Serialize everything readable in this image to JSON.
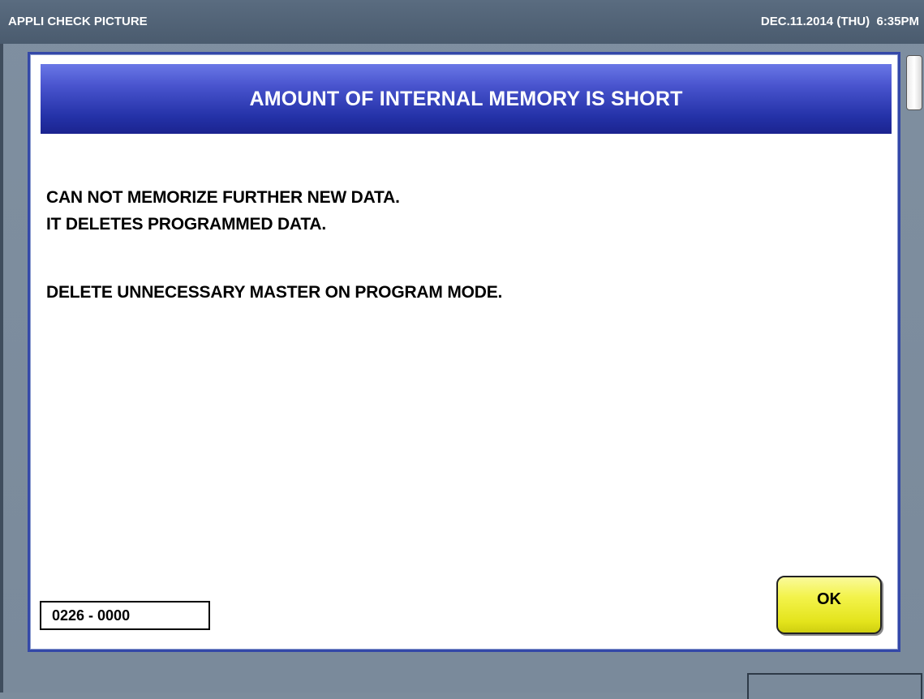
{
  "titlebar": {
    "app_title": "APPLI CHECK PICTURE",
    "datetime": "DEC.11.2014 (THU)  6:35PM"
  },
  "dialog": {
    "title": "AMOUNT OF INTERNAL MEMORY IS SHORT",
    "message_lines": [
      "CAN NOT MEMORIZE FURTHER NEW DATA.",
      "IT DELETES PROGRAMMED DATA.",
      "DELETE UNNECESSARY MASTER ON PROGRAM MODE."
    ],
    "error_code": "0226 - 0000",
    "ok_label": "OK"
  },
  "colors": {
    "titlebar": "#4f6175",
    "background": "#7c8c9c",
    "dialog_header": "#2a37b0",
    "dialog_border": "#3448a8",
    "ok_button": "#efef3a"
  }
}
